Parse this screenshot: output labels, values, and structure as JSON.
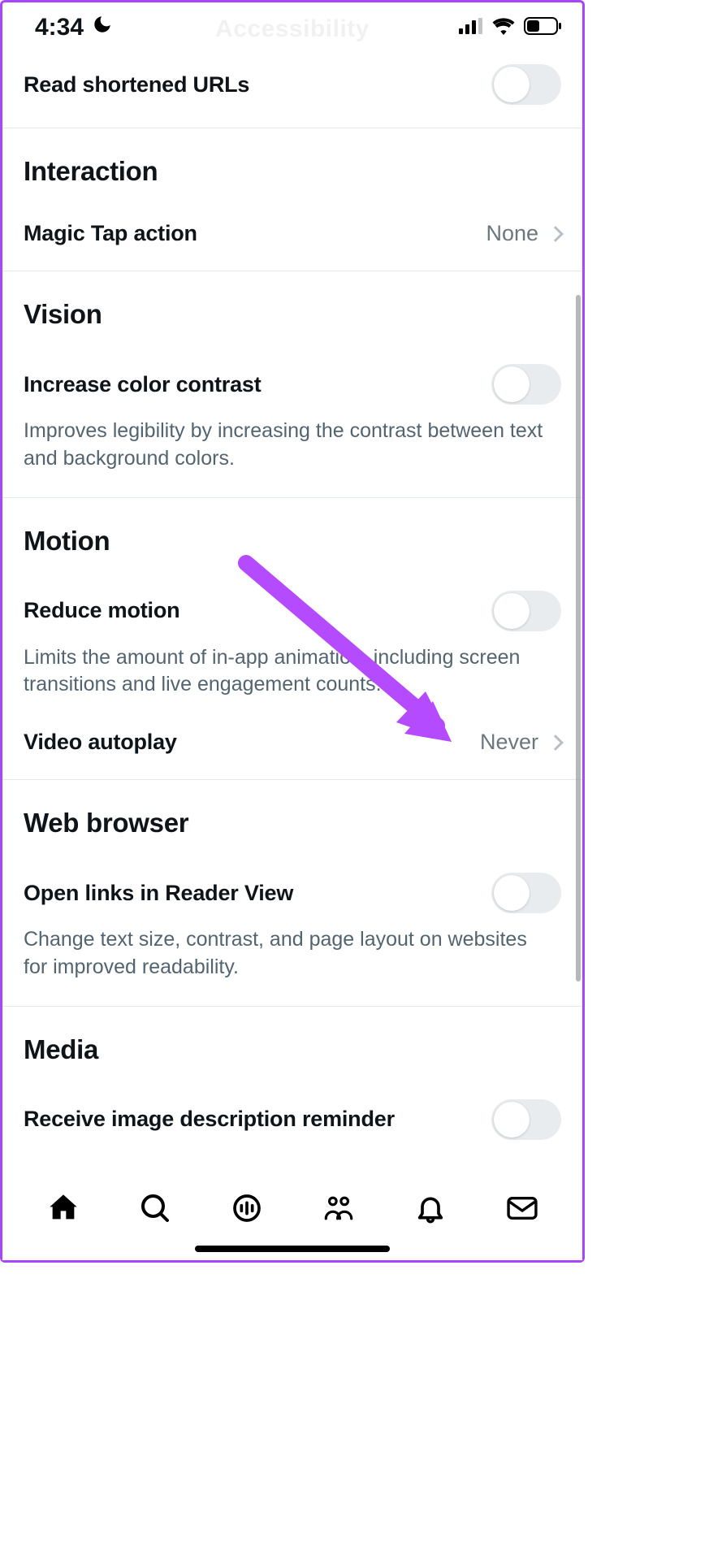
{
  "statusbar": {
    "time": "4:34",
    "page_title_faded": "Accessibility"
  },
  "read_urls": {
    "label": "Read shortened URLs"
  },
  "interaction": {
    "title": "Interaction",
    "magic_tap": {
      "label": "Magic Tap action",
      "value": "None"
    }
  },
  "vision": {
    "title": "Vision",
    "contrast": {
      "label": "Increase color contrast",
      "desc": "Improves legibility by increasing the contrast between text and background colors."
    }
  },
  "motion": {
    "title": "Motion",
    "reduce": {
      "label": "Reduce motion",
      "desc": "Limits the amount of in-app animation, including screen transitions and live engagement counts."
    },
    "autoplay": {
      "label": "Video autoplay",
      "value": "Never"
    }
  },
  "web": {
    "title": "Web browser",
    "reader": {
      "label": "Open links in Reader View",
      "desc": "Change text size, contrast, and page layout on websites for improved readability."
    }
  },
  "media": {
    "title": "Media",
    "reminder": {
      "label": "Receive image description reminder"
    }
  }
}
